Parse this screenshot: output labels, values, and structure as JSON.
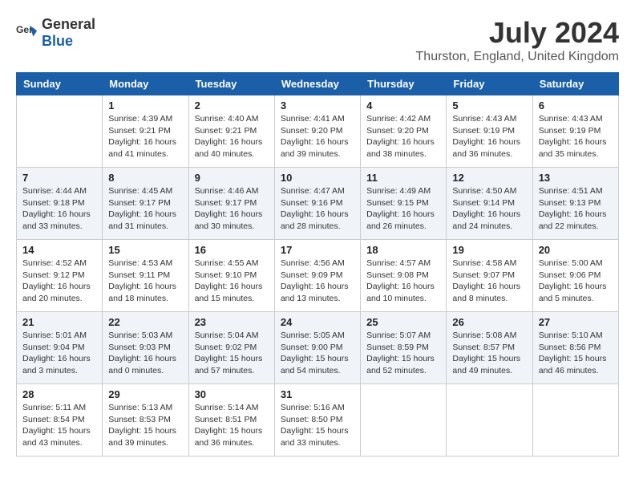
{
  "header": {
    "logo_general": "General",
    "logo_blue": "Blue",
    "month_title": "July 2024",
    "location": "Thurston, England, United Kingdom"
  },
  "days_of_week": [
    "Sunday",
    "Monday",
    "Tuesday",
    "Wednesday",
    "Thursday",
    "Friday",
    "Saturday"
  ],
  "weeks": [
    [
      {
        "day": "",
        "sunrise": "",
        "sunset": "",
        "daylight": ""
      },
      {
        "day": "1",
        "sunrise": "Sunrise: 4:39 AM",
        "sunset": "Sunset: 9:21 PM",
        "daylight": "Daylight: 16 hours and 41 minutes."
      },
      {
        "day": "2",
        "sunrise": "Sunrise: 4:40 AM",
        "sunset": "Sunset: 9:21 PM",
        "daylight": "Daylight: 16 hours and 40 minutes."
      },
      {
        "day": "3",
        "sunrise": "Sunrise: 4:41 AM",
        "sunset": "Sunset: 9:20 PM",
        "daylight": "Daylight: 16 hours and 39 minutes."
      },
      {
        "day": "4",
        "sunrise": "Sunrise: 4:42 AM",
        "sunset": "Sunset: 9:20 PM",
        "daylight": "Daylight: 16 hours and 38 minutes."
      },
      {
        "day": "5",
        "sunrise": "Sunrise: 4:43 AM",
        "sunset": "Sunset: 9:19 PM",
        "daylight": "Daylight: 16 hours and 36 minutes."
      },
      {
        "day": "6",
        "sunrise": "Sunrise: 4:43 AM",
        "sunset": "Sunset: 9:19 PM",
        "daylight": "Daylight: 16 hours and 35 minutes."
      }
    ],
    [
      {
        "day": "7",
        "sunrise": "Sunrise: 4:44 AM",
        "sunset": "Sunset: 9:18 PM",
        "daylight": "Daylight: 16 hours and 33 minutes."
      },
      {
        "day": "8",
        "sunrise": "Sunrise: 4:45 AM",
        "sunset": "Sunset: 9:17 PM",
        "daylight": "Daylight: 16 hours and 31 minutes."
      },
      {
        "day": "9",
        "sunrise": "Sunrise: 4:46 AM",
        "sunset": "Sunset: 9:17 PM",
        "daylight": "Daylight: 16 hours and 30 minutes."
      },
      {
        "day": "10",
        "sunrise": "Sunrise: 4:47 AM",
        "sunset": "Sunset: 9:16 PM",
        "daylight": "Daylight: 16 hours and 28 minutes."
      },
      {
        "day": "11",
        "sunrise": "Sunrise: 4:49 AM",
        "sunset": "Sunset: 9:15 PM",
        "daylight": "Daylight: 16 hours and 26 minutes."
      },
      {
        "day": "12",
        "sunrise": "Sunrise: 4:50 AM",
        "sunset": "Sunset: 9:14 PM",
        "daylight": "Daylight: 16 hours and 24 minutes."
      },
      {
        "day": "13",
        "sunrise": "Sunrise: 4:51 AM",
        "sunset": "Sunset: 9:13 PM",
        "daylight": "Daylight: 16 hours and 22 minutes."
      }
    ],
    [
      {
        "day": "14",
        "sunrise": "Sunrise: 4:52 AM",
        "sunset": "Sunset: 9:12 PM",
        "daylight": "Daylight: 16 hours and 20 minutes."
      },
      {
        "day": "15",
        "sunrise": "Sunrise: 4:53 AM",
        "sunset": "Sunset: 9:11 PM",
        "daylight": "Daylight: 16 hours and 18 minutes."
      },
      {
        "day": "16",
        "sunrise": "Sunrise: 4:55 AM",
        "sunset": "Sunset: 9:10 PM",
        "daylight": "Daylight: 16 hours and 15 minutes."
      },
      {
        "day": "17",
        "sunrise": "Sunrise: 4:56 AM",
        "sunset": "Sunset: 9:09 PM",
        "daylight": "Daylight: 16 hours and 13 minutes."
      },
      {
        "day": "18",
        "sunrise": "Sunrise: 4:57 AM",
        "sunset": "Sunset: 9:08 PM",
        "daylight": "Daylight: 16 hours and 10 minutes."
      },
      {
        "day": "19",
        "sunrise": "Sunrise: 4:58 AM",
        "sunset": "Sunset: 9:07 PM",
        "daylight": "Daylight: 16 hours and 8 minutes."
      },
      {
        "day": "20",
        "sunrise": "Sunrise: 5:00 AM",
        "sunset": "Sunset: 9:06 PM",
        "daylight": "Daylight: 16 hours and 5 minutes."
      }
    ],
    [
      {
        "day": "21",
        "sunrise": "Sunrise: 5:01 AM",
        "sunset": "Sunset: 9:04 PM",
        "daylight": "Daylight: 16 hours and 3 minutes."
      },
      {
        "day": "22",
        "sunrise": "Sunrise: 5:03 AM",
        "sunset": "Sunset: 9:03 PM",
        "daylight": "Daylight: 16 hours and 0 minutes."
      },
      {
        "day": "23",
        "sunrise": "Sunrise: 5:04 AM",
        "sunset": "Sunset: 9:02 PM",
        "daylight": "Daylight: 15 hours and 57 minutes."
      },
      {
        "day": "24",
        "sunrise": "Sunrise: 5:05 AM",
        "sunset": "Sunset: 9:00 PM",
        "daylight": "Daylight: 15 hours and 54 minutes."
      },
      {
        "day": "25",
        "sunrise": "Sunrise: 5:07 AM",
        "sunset": "Sunset: 8:59 PM",
        "daylight": "Daylight: 15 hours and 52 minutes."
      },
      {
        "day": "26",
        "sunrise": "Sunrise: 5:08 AM",
        "sunset": "Sunset: 8:57 PM",
        "daylight": "Daylight: 15 hours and 49 minutes."
      },
      {
        "day": "27",
        "sunrise": "Sunrise: 5:10 AM",
        "sunset": "Sunset: 8:56 PM",
        "daylight": "Daylight: 15 hours and 46 minutes."
      }
    ],
    [
      {
        "day": "28",
        "sunrise": "Sunrise: 5:11 AM",
        "sunset": "Sunset: 8:54 PM",
        "daylight": "Daylight: 15 hours and 43 minutes."
      },
      {
        "day": "29",
        "sunrise": "Sunrise: 5:13 AM",
        "sunset": "Sunset: 8:53 PM",
        "daylight": "Daylight: 15 hours and 39 minutes."
      },
      {
        "day": "30",
        "sunrise": "Sunrise: 5:14 AM",
        "sunset": "Sunset: 8:51 PM",
        "daylight": "Daylight: 15 hours and 36 minutes."
      },
      {
        "day": "31",
        "sunrise": "Sunrise: 5:16 AM",
        "sunset": "Sunset: 8:50 PM",
        "daylight": "Daylight: 15 hours and 33 minutes."
      },
      {
        "day": "",
        "sunrise": "",
        "sunset": "",
        "daylight": ""
      },
      {
        "day": "",
        "sunrise": "",
        "sunset": "",
        "daylight": ""
      },
      {
        "day": "",
        "sunrise": "",
        "sunset": "",
        "daylight": ""
      }
    ]
  ]
}
